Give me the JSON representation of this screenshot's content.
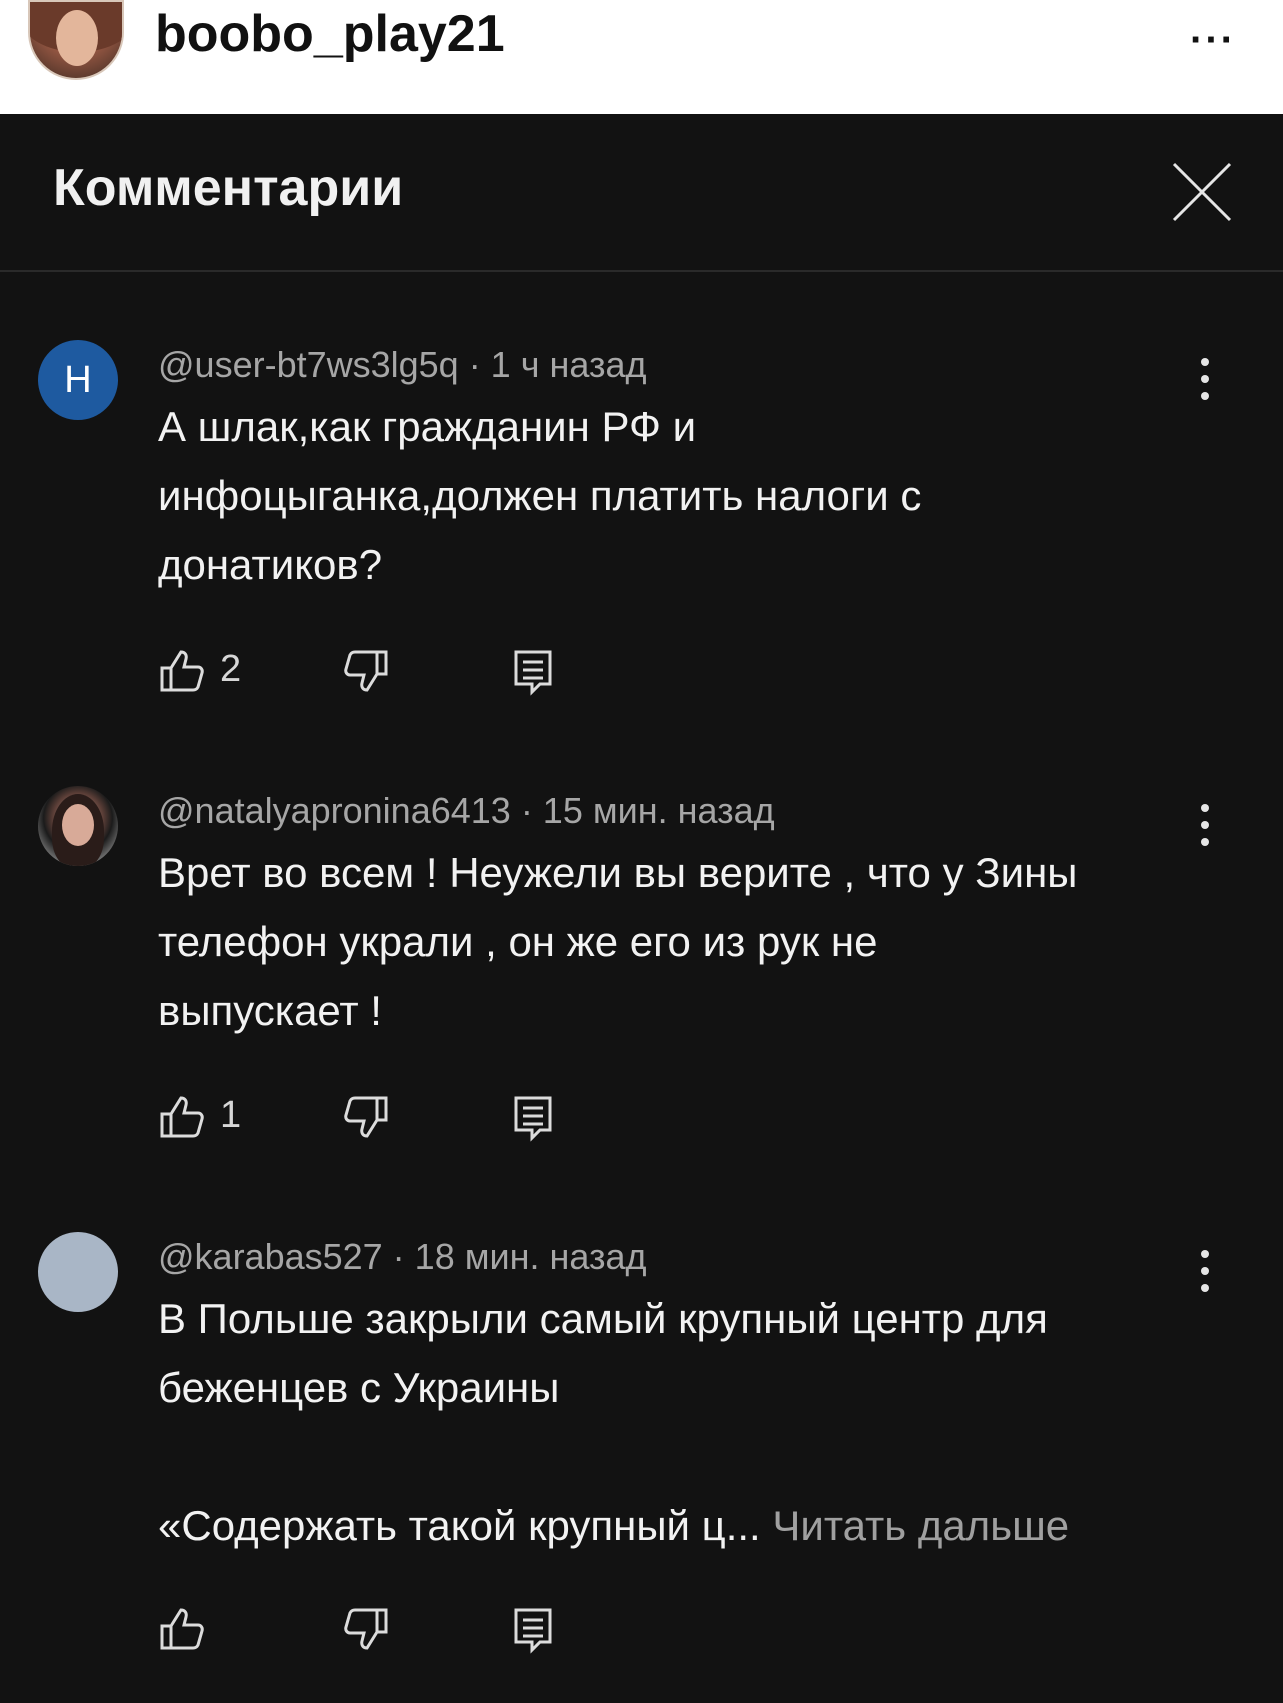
{
  "header": {
    "username": "boobo_play21",
    "more_label": "···"
  },
  "panel": {
    "title": "Комментарии"
  },
  "comments": [
    {
      "avatar_letter": "Н",
      "meta": "@user-bt7ws3lg5q · 1 ч назад",
      "text": "А шлак,как гражданин РФ и\nинфоцыганка,должен платить налоги с\nдонатиков?",
      "likes": "2"
    },
    {
      "meta": "@natalyapronina6413 · 15 мин. назад",
      "text": "Врет во всем ! Неужели вы верите , что у Зины\nтелефон украли , он же его из рук не\nвыпускает !",
      "likes": "1"
    },
    {
      "meta": "@karabas527 · 18 мин. назад",
      "text": "В Польше закрыли самый крупный центр для\nбеженцев с Украины\n\n«Содержать такой крупный ц... ",
      "read_more": "Читать дальше",
      "likes": ""
    }
  ],
  "colors": {
    "background": "#121212",
    "letter_avatar": "#1e5aa0"
  }
}
